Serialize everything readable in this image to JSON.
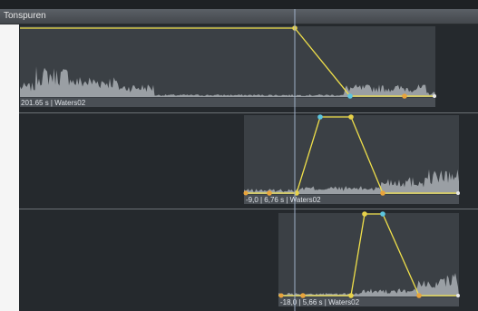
{
  "header": {
    "title": "Tonspuren"
  },
  "tracks": [
    {
      "label": "201.65 s | Waters02"
    },
    {
      "label": "-9,0 | 6,76 s | Waters02"
    },
    {
      "label": "-18,0 | 5,66 s | Waters02"
    }
  ],
  "colors": {
    "envelope": "#f0e04a",
    "waveform": "#9a9fa4",
    "clip_bg": "#3b4045",
    "label_bar": "#4a4f55",
    "playhead": "#9fb0c8",
    "handle_orange": "#e8a33c",
    "handle_cyan": "#5cc6e0"
  }
}
